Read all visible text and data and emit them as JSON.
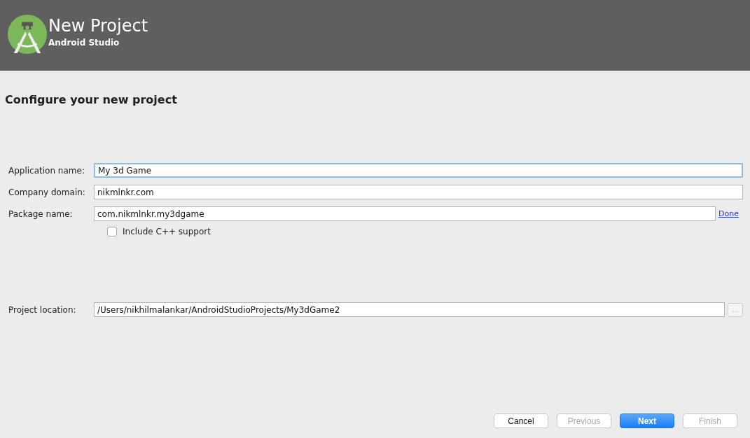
{
  "header": {
    "title": "New Project",
    "subtitle": "Android Studio"
  },
  "page_title": "Configure your new project",
  "fields": [
    {
      "label": "Application name:",
      "value": "My 3d Game",
      "focused": true
    },
    {
      "label": "Company domain:",
      "value": "nikmlnkr.com",
      "focused": false
    },
    {
      "label": "Package name:",
      "value": "com.nikmlnkr.my3dgame",
      "focused": false,
      "action": {
        "kind": "link",
        "label": "Done"
      }
    }
  ],
  "checkbox": {
    "label": "Include C++ support",
    "checked": false
  },
  "location": {
    "label": "Project location:",
    "value": "/Users/nikhilmalankar/AndroidStudioProjects/My3dGame2",
    "focused": false,
    "action": {
      "kind": "browse",
      "label": "..."
    }
  },
  "buttons": [
    {
      "label": "Cancel",
      "kind": "default",
      "disabled": false
    },
    {
      "label": "Previous",
      "kind": "default",
      "disabled": true
    },
    {
      "label": "Next",
      "kind": "primary",
      "disabled": false
    },
    {
      "label": "Finish",
      "kind": "default",
      "disabled": true
    }
  ]
}
